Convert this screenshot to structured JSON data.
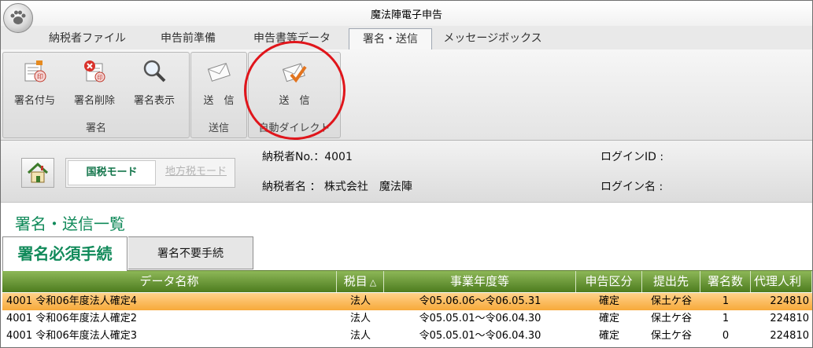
{
  "window": {
    "title": "魔法陣電子申告"
  },
  "tabs": [
    {
      "label": "納税者ファイル"
    },
    {
      "label": "申告前準備"
    },
    {
      "label": "申告書等データ"
    },
    {
      "label": "署名・送信",
      "active": true
    },
    {
      "label": "メッセージボックス"
    }
  ],
  "ribbon": {
    "groups": {
      "signature": {
        "label": "署名",
        "buttons": [
          "署名付与",
          "署名削除",
          "署名表示"
        ]
      },
      "send": {
        "label": "送信",
        "button": "送　信"
      },
      "auto_direct": {
        "label": "自動ダイレクト",
        "button": "送　信"
      }
    },
    "icons": [
      "sign-add-icon",
      "sign-delete-icon",
      "magnifier-icon",
      "envelope-icon",
      "envelope-check-icon"
    ]
  },
  "info": {
    "mode_active": "国税モード",
    "mode_inactive": "地方税モード",
    "taxpayer_no": "納税者No.：4001",
    "taxpayer_name": "納税者名 ： 株式会社　魔法陣",
    "login_id": "ログインID :",
    "login_name": "ログイン名 :"
  },
  "section": {
    "title": "署名・送信一覧"
  },
  "subtabs": {
    "required": "署名必須手続",
    "not_required": "署名不要手続"
  },
  "table": {
    "columns": [
      "データ名称",
      "税目",
      "事業年度等",
      "申告区分",
      "提出先",
      "署名数",
      "代理人利"
    ],
    "sort_indicator": "△",
    "rows": [
      {
        "name": "4001 令和06年度法人確定4",
        "tax": "法人",
        "period": "令05.06.06～令06.05.31",
        "kind": "確定",
        "office": "保土ケ谷",
        "sigs": "1",
        "agent": "224810",
        "selected": true
      },
      {
        "name": "4001 令和06年度法人確定2",
        "tax": "法人",
        "period": "令05.05.01～令06.04.30",
        "kind": "確定",
        "office": "保土ケ谷",
        "sigs": "1",
        "agent": "224810"
      },
      {
        "name": "4001 令和06年度法人確定3",
        "tax": "法人",
        "period": "令05.05.01～令06.04.30",
        "kind": "確定",
        "office": "保土ケ谷",
        "sigs": "0",
        "agent": "224810"
      }
    ]
  },
  "colors": {
    "accent_green": "#118a5a",
    "header_green": "#5c8a28",
    "selection": "#f7b04a",
    "annotation_red": "#e0151b"
  }
}
